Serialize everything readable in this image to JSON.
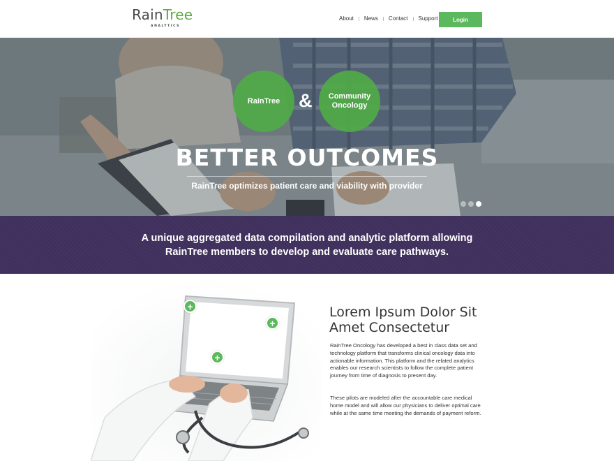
{
  "header": {
    "logo": {
      "word_left": "Rain",
      "word_right": "Tree",
      "tagline": "ANALYTICS"
    },
    "nav": [
      "About",
      "News",
      "Contact",
      "Support"
    ],
    "login_label": "Login"
  },
  "hero": {
    "circle_left": "RainTree",
    "ampersand": "&",
    "circle_right": "Community Oncology",
    "title": "BETTER OUTCOMES",
    "subtitle": "RainTree optimizes patient care and viability with provider",
    "slides": 3,
    "active_slide": 3
  },
  "band": {
    "text": "A unique aggregated data compilation and analytic platform allowing RainTree members to develop and evaluate care pathways."
  },
  "content": {
    "title": "Lorem Ipsum Dolor Sit Amet Consectetur",
    "paragraph_1": "RainTree Oncology has developed a best in class data set and technology platform that transforms clinical oncology data into actionable information. This platform and the related analytics enables our research scientists to follow the complete patient journey from time of diagnosis to present day.",
    "paragraph_2": "These pilots are modeled after the accountable care medical home model and will allow our physicians to deliver optimal care while at the same time meeting the demands of payment reform.",
    "plus_symbol": "+"
  },
  "colors": {
    "brand_green": "#5cb85c",
    "band_purple": "#3f2f5c",
    "text_dark": "#333333"
  }
}
